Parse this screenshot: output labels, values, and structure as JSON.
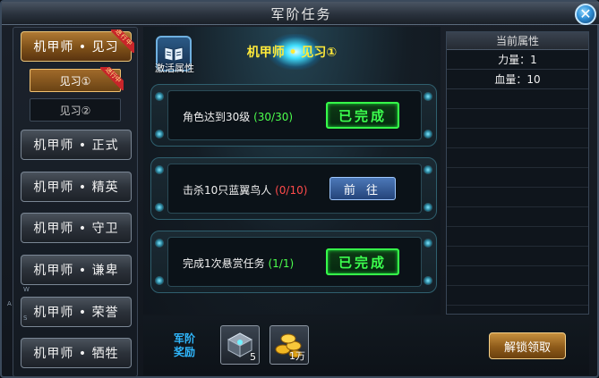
{
  "window": {
    "title": "军阶任务",
    "close_symbol": "✕"
  },
  "sidebar": {
    "active_tier": {
      "label": "机甲师 • 见习",
      "ribbon": "进行中"
    },
    "sub_items": [
      {
        "label": "见习①",
        "ribbon": "进行中"
      },
      {
        "label": "见习②"
      }
    ],
    "tiers": [
      {
        "label": "机甲师 • 正式"
      },
      {
        "label": "机甲师 • 精英"
      },
      {
        "label": "机甲师 • 守卫"
      },
      {
        "label": "机甲师 • 谦卑"
      },
      {
        "label": "机甲师 • 荣誉"
      },
      {
        "label": "机甲师 • 牺牲"
      }
    ]
  },
  "main": {
    "activate_label": "激活属性",
    "sub_title": "机甲师 • 见习①",
    "tasks": [
      {
        "text": "角色达到30级",
        "progress": "(30/30)",
        "status": "已完成"
      },
      {
        "text": "击杀10只蓝翼鸟人",
        "progress": "(0/10)",
        "action": "前 往"
      },
      {
        "text": "完成1次悬赏任务",
        "progress": "(1/1)",
        "status": "已完成"
      }
    ]
  },
  "attributes": {
    "header": "当前属性",
    "rows": [
      {
        "text": "力量：1"
      },
      {
        "text": "血量：10"
      }
    ]
  },
  "rewards": {
    "label_line1": "军阶",
    "label_line2": "奖励",
    "items": [
      {
        "icon": "crate-icon",
        "count": "5"
      },
      {
        "icon": "gold-icon",
        "count": "1万"
      }
    ],
    "claim_label": "解锁领取"
  },
  "side_letters": {
    "w": "W",
    "a": "A",
    "s": "S"
  },
  "colors": {
    "done": "#3cff4e",
    "progress_ok": "#4dff4d",
    "progress_bad": "#ff4a4a",
    "accent_gold": "#ffea3a"
  }
}
